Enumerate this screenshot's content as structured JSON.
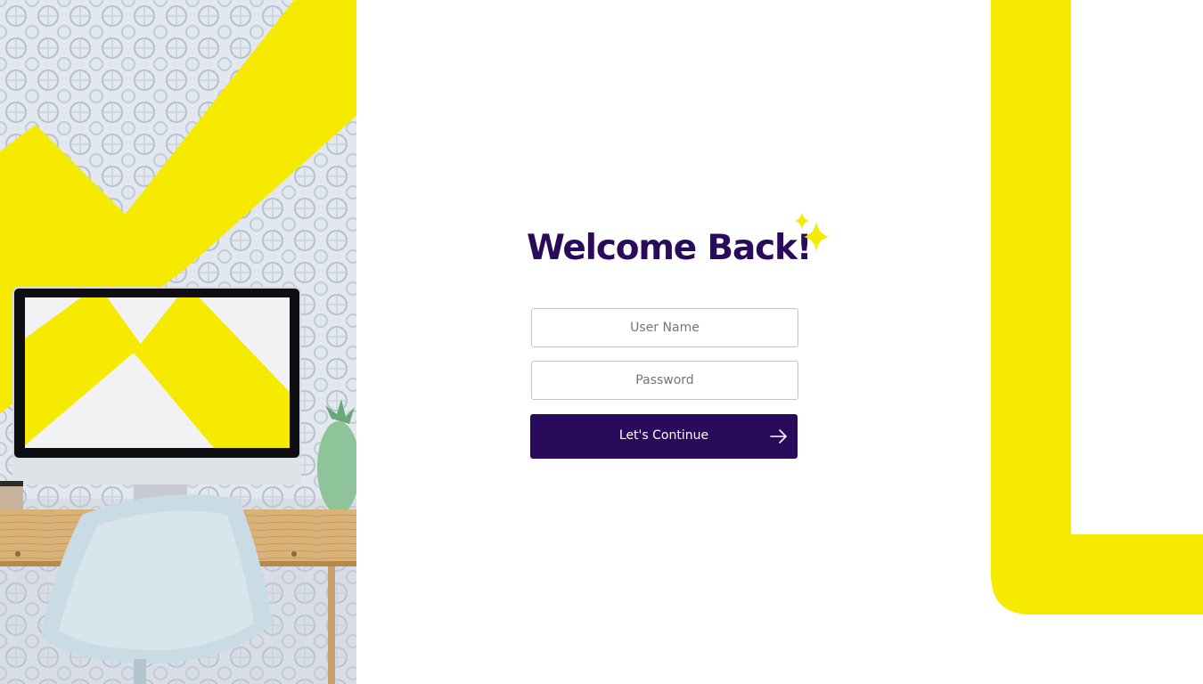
{
  "login": {
    "title": "Welcome Back!",
    "username_placeholder": "User Name",
    "password_placeholder": "Password",
    "continue_label": "Let's Continue"
  },
  "icons": {
    "sparkle": "sparkle-icon",
    "continue_arrow": "arrow-right-icon"
  },
  "colors": {
    "brand_purple": "#2a0a5a",
    "accent_yellow": "#f5ea00",
    "background": "#ffffff"
  }
}
